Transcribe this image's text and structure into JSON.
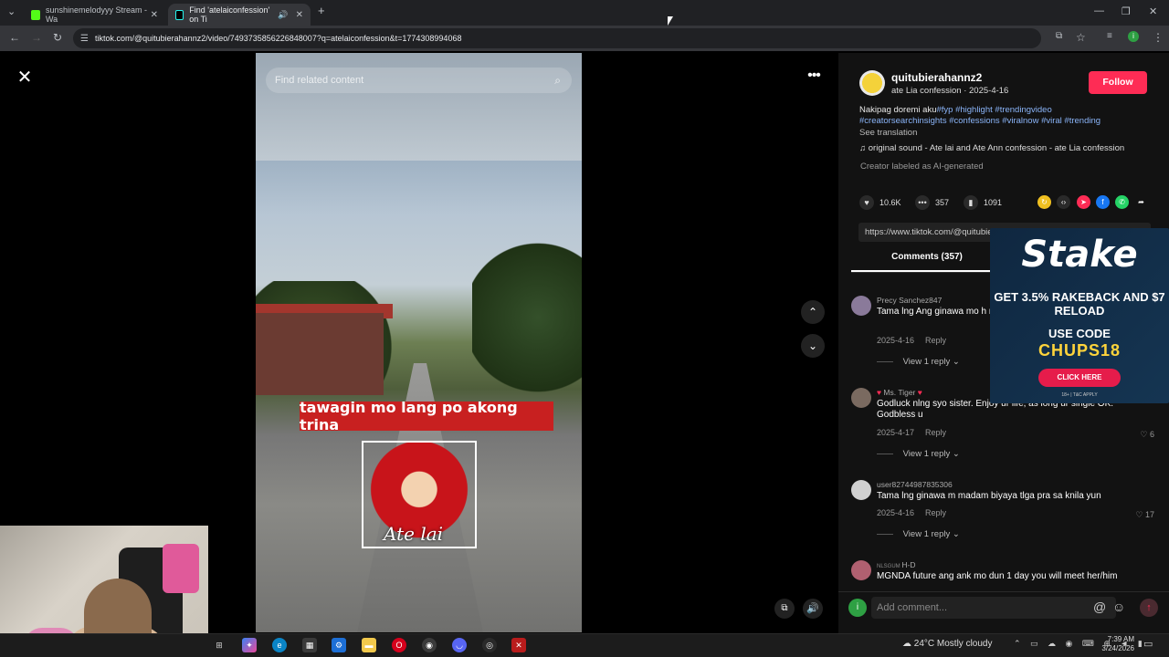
{
  "browser": {
    "tabs": [
      {
        "title": "sunshinemelodyyy Stream - Wa",
        "color": "#53fc18"
      },
      {
        "title": "Find 'atelaiconfession' on Ti",
        "color": "#000000"
      }
    ],
    "new_tab": "+",
    "url": "tiktok.com/@quitubierahannz2/video/7493735856226848007?q=atelaiconfession&t=1774308994068"
  },
  "video": {
    "search_placeholder": "Find related content",
    "caption": "tawagin mo lang po akong trina",
    "logo_text": "Ate lai"
  },
  "post": {
    "author": "quitubierahannz2",
    "subtitle": "ate Lia confession · 2025-4-16",
    "follow_label": "Follow",
    "desc_text": "Nakipag doremi aku",
    "hashtags_line1": "#fyp #highlight #trendingvideo",
    "hashtags_line2": "#creatorsearchinsights #confessions #viralnow #viral #trending",
    "see_translation": "See translation",
    "sound": "original sound - Ate lai and Ate Ann confession - ate Lia confession",
    "ai_label": "Creator labeled as AI-generated",
    "likes": "10.6K",
    "comments": "357",
    "saves": "1091",
    "link": "https://www.tiktok.com/@quitubierahannz2/video/7493735856226848007"
  },
  "comments_tab": "Comments (357)",
  "comments": [
    {
      "user": "Precy Sanchez847",
      "text": "Tama lng Ang ginawa mo h mabigyan pa sya Ng magar",
      "date": "2025-4-16",
      "reply": "Reply",
      "likes": "",
      "view": "View 1 reply",
      "avatar": "#8a7a9a"
    },
    {
      "user": "Ms. Tiger",
      "text": "Godluck nlng syo sister. Enjoy ur life, as long ur single OK. Godbless u",
      "date": "2025-4-17",
      "reply": "Reply",
      "likes": "6",
      "view": "View 1 reply",
      "avatar": "#7a6a60"
    },
    {
      "user": "user82744987835306",
      "text": "Tama lng ginawa m madam biyaya tlga pra sa knila yun",
      "date": "2025-4-16",
      "reply": "Reply",
      "likes": "17",
      "view": "View 1 reply",
      "avatar": "#d0d0d0"
    },
    {
      "user": "H-D",
      "text": "MGNDA future ang ank mo dun 1 day you will meet her/him",
      "date": "",
      "reply": "",
      "likes": "",
      "view": "",
      "avatar": "#b06070"
    }
  ],
  "ad": {
    "brand": "Stake",
    "offer": "GET 3.5% RAKEBACK AND $7 RELOAD",
    "use": "USE CODE",
    "code": "CHUPS18",
    "cta": "CLICK HERE",
    "tc": "18+ | T&C APPLY"
  },
  "composer": {
    "avatar_letter": "i",
    "placeholder": "Add comment..."
  },
  "taskbar": {
    "weather": "24°C  Mostly cloudy",
    "time": "7:39 AM",
    "date": "3/24/2026"
  },
  "colors": {
    "accent": "#fe2c55",
    "link": "#8ab4f8"
  }
}
